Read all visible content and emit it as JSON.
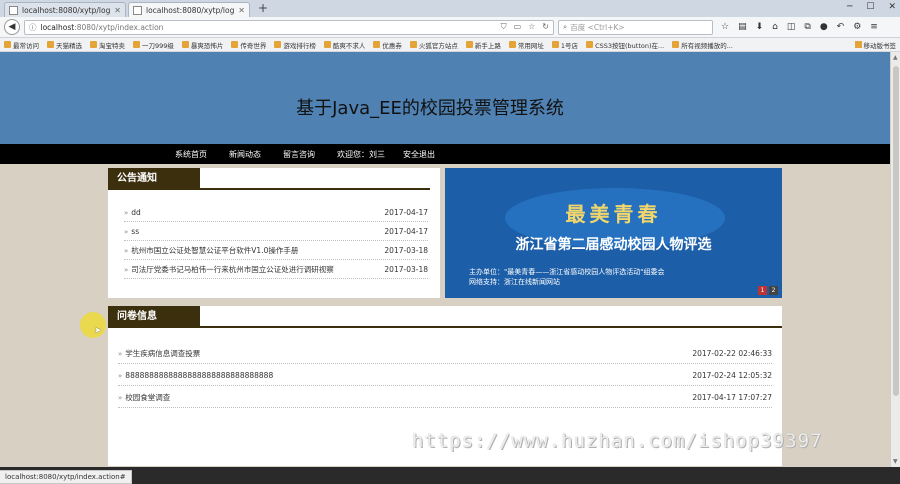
{
  "browser": {
    "tabs": [
      {
        "label": "localhost:8080/xytp/login..."
      },
      {
        "label": "localhost:8080/xytp/login..."
      }
    ],
    "new_tab": "+",
    "url_host": "localhost",
    "url_path": ":8080/xytp/index.action",
    "search_placeholder": "百度 <Ctrl+K>",
    "bookmarks": [
      "最常访问",
      "天猫精选",
      "淘宝特卖",
      "一刀999级",
      "暴爽恐怖片",
      "传奇世界",
      "游戏排行榜",
      "酷爽不求人",
      "优惠券",
      "火狐官方站点",
      "新手上路",
      "常用网址",
      "1号店",
      "CSS3按钮(button)在...",
      "所有视频播放的..."
    ],
    "bookmark_right": "移动版书签",
    "status_url": "localhost:8080/xytp/index.action#"
  },
  "site": {
    "title": "基于Java_EE的校园投票管理系统",
    "menu": {
      "home": "系统首页",
      "news": "新闻动态",
      "message": "留言咨询",
      "welcome": "欢迎您：刘三",
      "logout": "安全退出"
    }
  },
  "notice": {
    "heading": "公告通知",
    "items": [
      {
        "title": "dd",
        "date": "2017-04-17"
      },
      {
        "title": "ss",
        "date": "2017-04-17"
      },
      {
        "title": "杭州市国立公证处智慧公证平台软件V1.0操作手册",
        "date": "2017-03-18"
      },
      {
        "title": "司法厅党委书记马柏伟一行来杭州市国立公证处进行调研视察",
        "date": "2017-03-18"
      }
    ]
  },
  "promo": {
    "headline": "最美青春",
    "subtitle": "浙江省第二届感动校园人物评选",
    "line1": "主办单位：\"最美青春——浙江省感动校园人物评选活动\"组委会",
    "line2": "网络支持：浙江在线新闻网站",
    "pager": [
      "1",
      "2"
    ]
  },
  "survey": {
    "heading": "问卷信息",
    "items": [
      {
        "title": "学生疾病信息调查投票",
        "date": "2017-02-22 02:46:33"
      },
      {
        "title": "8888888888888888888888888888888",
        "date": "2017-02-24 12:05:32"
      },
      {
        "title": "校园食堂调查",
        "date": "2017-04-17 17:07:27"
      }
    ]
  },
  "watermark": "https://www.huzhan.com/ishop39397"
}
